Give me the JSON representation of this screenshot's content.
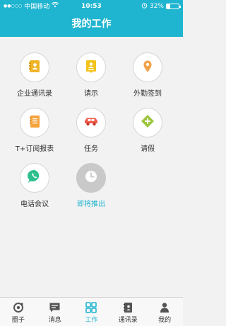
{
  "status": {
    "carrier": "中国移动",
    "time": "10:53",
    "battery_text": "32%",
    "battery_level": 0.32
  },
  "header": {
    "title": "我的工作"
  },
  "tiles": [
    {
      "label": "企业通讯录",
      "icon": "contacts-book-icon",
      "color": "#f0b429"
    },
    {
      "label": "请示",
      "icon": "request-doc-icon",
      "color": "#f2c41b"
    },
    {
      "label": "外勤签到",
      "icon": "location-pin-icon",
      "color": "#f0a24a"
    },
    {
      "label": "T+订阅报表",
      "icon": "report-doc-icon",
      "color": "#f5a23b"
    },
    {
      "label": "任务",
      "icon": "car-icon",
      "color": "#f15a4a"
    },
    {
      "label": "请假",
      "icon": "leave-plus-icon",
      "color": "#9bc53d"
    },
    {
      "label": "电话会议",
      "icon": "phone-chat-icon",
      "color": "#2dbf8c"
    },
    {
      "label": "即将推出",
      "icon": "clock-icon",
      "color": "#c9c9c9"
    }
  ],
  "tabs": [
    {
      "label": "圈子",
      "icon": "circle-icon"
    },
    {
      "label": "消息",
      "icon": "message-icon"
    },
    {
      "label": "工作",
      "icon": "work-grid-icon",
      "active": true
    },
    {
      "label": "通讯录",
      "icon": "address-book-icon"
    },
    {
      "label": "我的",
      "icon": "person-icon"
    }
  ],
  "colors": {
    "accent": "#1fb4cf",
    "inactive_tab": "#555555"
  }
}
